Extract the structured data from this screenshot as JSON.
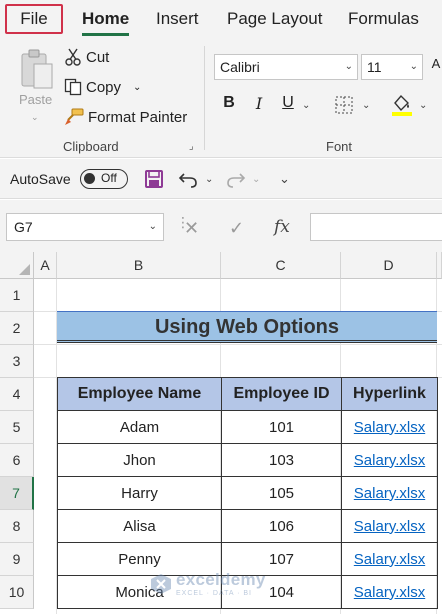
{
  "tabs": [
    "File",
    "Home",
    "Insert",
    "Page Layout",
    "Formulas"
  ],
  "clipboard": {
    "paste": "Paste",
    "cut": "Cut",
    "copy": "Copy",
    "format_painter": "Format Painter",
    "group_label": "Clipboard"
  },
  "font": {
    "name": "Calibri",
    "size": "11",
    "group_label": "Font",
    "bold": "B",
    "italic": "I",
    "underline": "U"
  },
  "qat": {
    "autosave_label": "AutoSave",
    "autosave_state": "Off"
  },
  "formula_bar": {
    "name_box": "G7",
    "fx": "fx",
    "value": ""
  },
  "sheet": {
    "columns": [
      "A",
      "B",
      "C",
      "D"
    ],
    "rows": [
      "1",
      "2",
      "3",
      "4",
      "5",
      "6",
      "7",
      "8",
      "9",
      "10"
    ],
    "active_row": "7",
    "title": "Using Web Options",
    "headers": [
      "Employee Name",
      "Employee ID",
      "Hyperlink"
    ],
    "data": [
      {
        "name": "Adam",
        "id": "101",
        "link": "Salary.xlsx"
      },
      {
        "name": "Jhon",
        "id": "103",
        "link": "Salary.xlsx"
      },
      {
        "name": "Harry",
        "id": "105",
        "link": "Salary.xlsx"
      },
      {
        "name": "Alisa",
        "id": "106",
        "link": "Salary.xlsx"
      },
      {
        "name": "Penny",
        "id": "107",
        "link": "Salary.xlsx"
      },
      {
        "name": "Monica",
        "id": "104",
        "link": "Salary.xlsx"
      }
    ]
  },
  "watermark": {
    "name": "exceldemy",
    "sub": "EXCEL · DATA · BI"
  },
  "colors": {
    "accent": "#217346",
    "title_fill": "#9cc2e5",
    "header_fill": "#b4c6e7",
    "link": "#0563c1",
    "file_border": "#d0314a"
  }
}
